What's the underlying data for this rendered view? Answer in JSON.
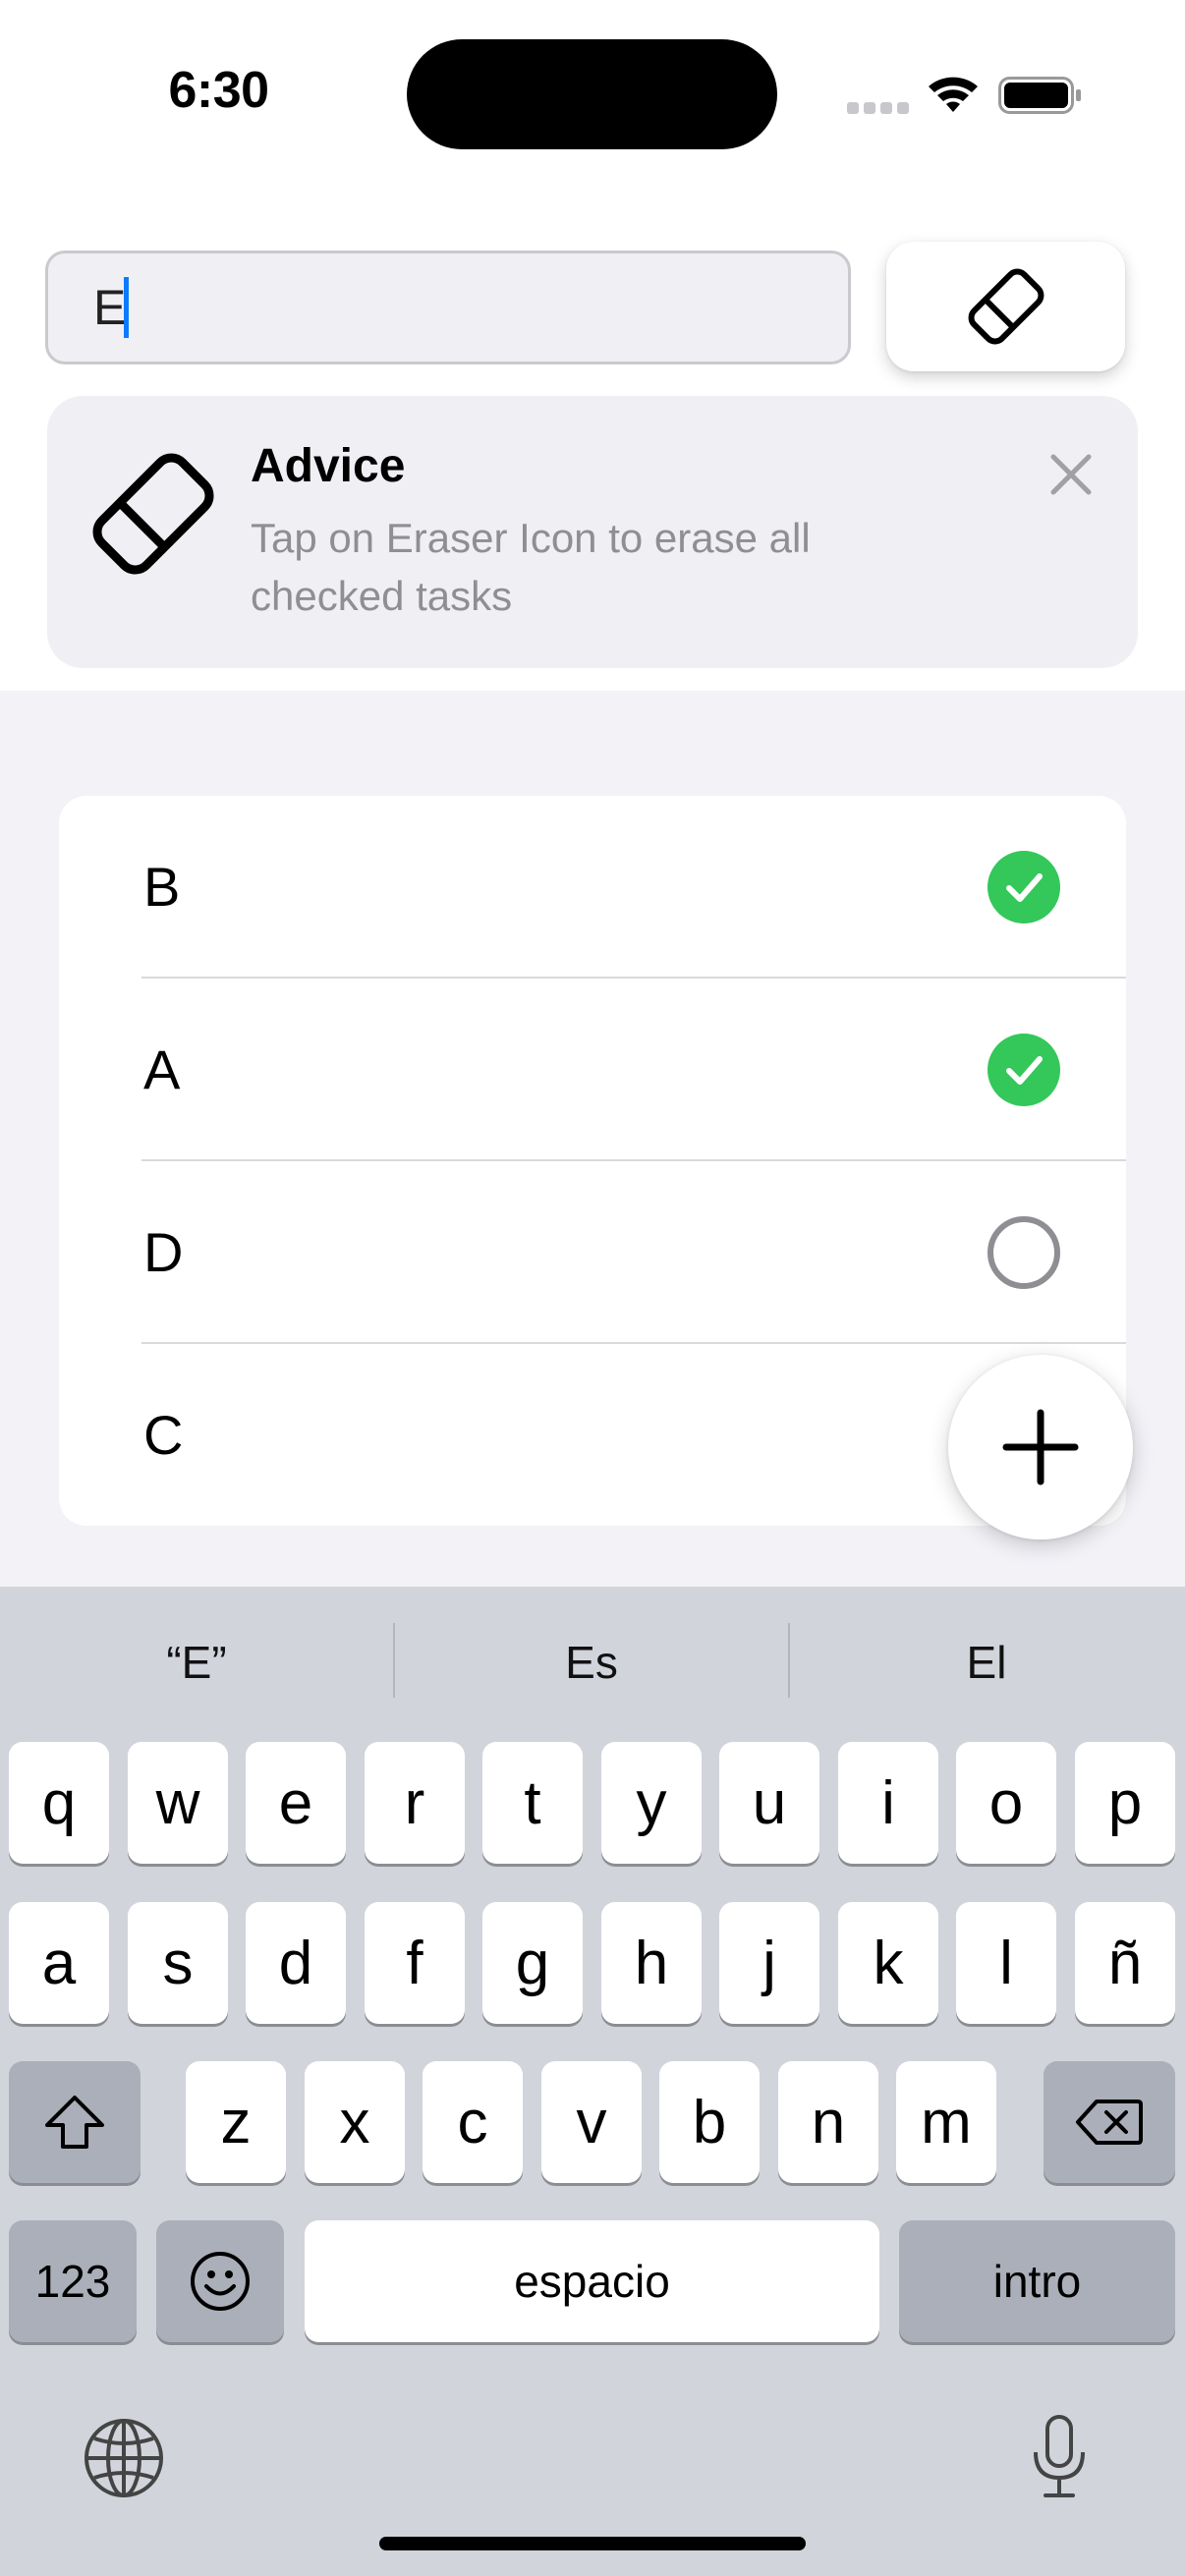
{
  "status_bar": {
    "time": "6:30"
  },
  "input": {
    "value": "E"
  },
  "advice": {
    "title": "Advice",
    "text": "Tap on Eraser Icon to erase all checked tasks"
  },
  "tasks": [
    {
      "label": "B",
      "checked": true
    },
    {
      "label": "A",
      "checked": true
    },
    {
      "label": "D",
      "checked": false
    },
    {
      "label": "C",
      "checked": false
    }
  ],
  "colors": {
    "check_green": "#34c759",
    "caret_blue": "#0a7aff"
  },
  "keyboard": {
    "suggestions": [
      "“E”",
      "Es",
      "El"
    ],
    "row1": [
      "q",
      "w",
      "e",
      "r",
      "t",
      "y",
      "u",
      "i",
      "o",
      "p"
    ],
    "row2": [
      "a",
      "s",
      "d",
      "f",
      "g",
      "h",
      "j",
      "k",
      "l",
      "ñ"
    ],
    "row3": [
      "z",
      "x",
      "c",
      "v",
      "b",
      "n",
      "m"
    ],
    "numbers_label": "123",
    "space_label": "espacio",
    "return_label": "intro"
  }
}
